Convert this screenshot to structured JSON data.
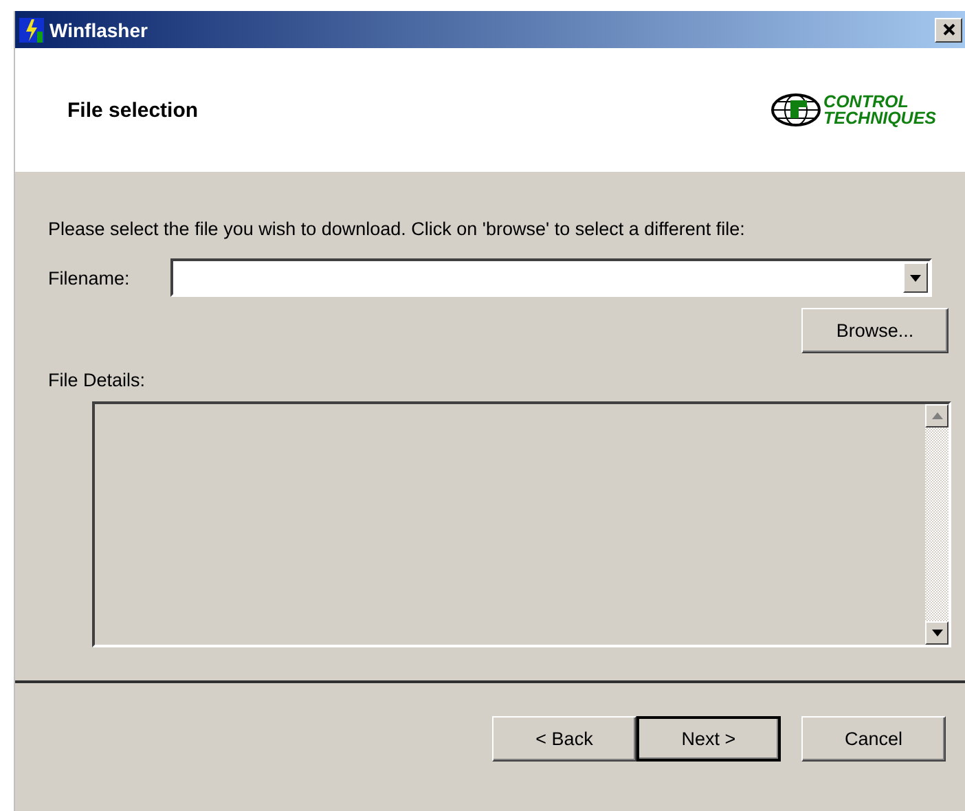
{
  "window": {
    "title": "Winflasher"
  },
  "header": {
    "title": "File selection",
    "logo_lines": [
      "CONTROL",
      "TECHNIQUES"
    ]
  },
  "instruction": "Please select the file you wish to download. Click on 'browse' to select a different file:",
  "filename": {
    "label": "Filename:"
  },
  "browse_button": "Browse...",
  "details": {
    "label": "File Details:"
  },
  "buttons": [
    {
      "label": "< Back",
      "default": false
    },
    {
      "label": "Next >",
      "default": true
    },
    {
      "label": "Cancel",
      "default": false
    }
  ]
}
